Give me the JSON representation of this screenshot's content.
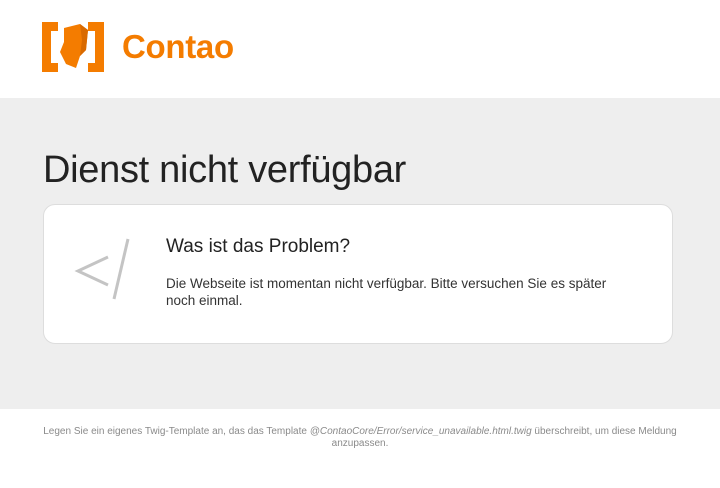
{
  "header": {
    "logo_text": "Contao",
    "logo_icon": "contao-logo-icon",
    "brand_color": "#f47c00"
  },
  "main": {
    "title": "Dienst nicht verfügbar",
    "card": {
      "icon": "code-slash-icon",
      "heading": "Was ist das Problem?",
      "text": "Die Webseite ist momentan nicht verfügbar. Bitte versuchen Sie es später noch einmal."
    }
  },
  "footer": {
    "text_before": "Legen Sie ein eigenes Twig-Template an, das das Template ",
    "template_path": "@ContaoCore/Error/service_unavailable.html.twig",
    "text_after": " überschreibt, um diese Meldung anzupassen."
  }
}
